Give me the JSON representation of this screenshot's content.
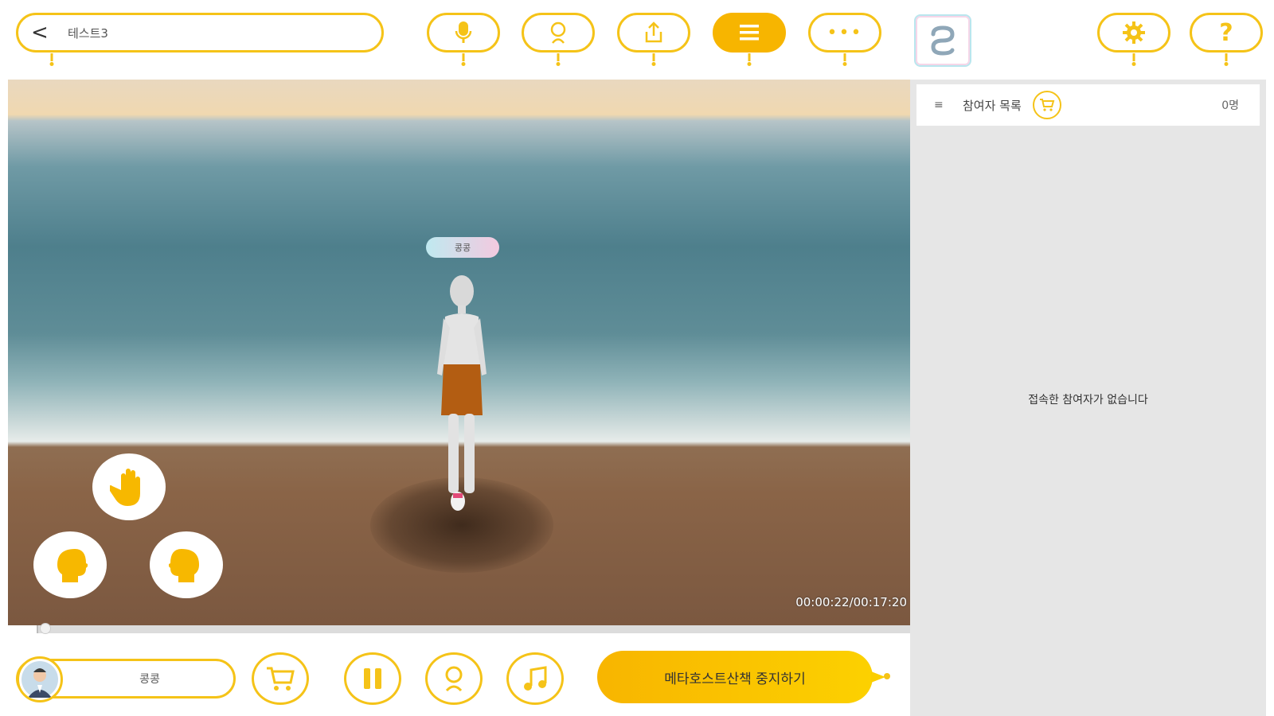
{
  "header": {
    "room_name": "테스트3",
    "back_glyph": "<"
  },
  "toolbar": {
    "icons": [
      "microphone-icon",
      "avatar-icon",
      "share-icon",
      "menu-icon",
      "more-icon",
      "link-icon",
      "settings-icon",
      "help-icon"
    ],
    "active": "menu-icon",
    "more_glyph": "•••",
    "help_glyph": "?",
    "accent": "#f5c318",
    "active_color": "#f7b500"
  },
  "stage": {
    "nametag": "콩콩",
    "timecode": "00:00:22/00:17:20",
    "progress": 0.021,
    "gesture_buttons": [
      "hand-icon",
      "head-left-icon",
      "head-right-icon"
    ]
  },
  "bottom": {
    "user_name": "콩콩",
    "controls": [
      "cart-icon",
      "pause-icon",
      "avatar-icon",
      "music-icon"
    ],
    "stop_label": "메타호스트산책 중지하기"
  },
  "panel": {
    "menu_glyph": "≡",
    "title": "참여자 목록",
    "count": "0명",
    "empty_text": "접속한 참여자가 없습니다"
  }
}
